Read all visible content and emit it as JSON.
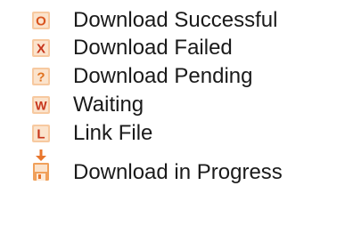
{
  "legend": {
    "items": [
      {
        "icon": "download-successful-icon",
        "glyph": "O",
        "label": "Download Successful",
        "color": "#e8762c"
      },
      {
        "icon": "download-failed-icon",
        "glyph": "X",
        "label": "Download Failed",
        "color": "#e8762c"
      },
      {
        "icon": "download-pending-icon",
        "glyph": "?",
        "label": "Download Pending",
        "color": "#e8762c"
      },
      {
        "icon": "waiting-icon",
        "glyph": "W",
        "label": "Waiting",
        "color": "#e8762c"
      },
      {
        "icon": "link-file-icon",
        "glyph": "L",
        "label": "Link File",
        "color": "#e8762c"
      },
      {
        "icon": "download-in-progress-icon",
        "glyph": "",
        "label": "Download in Progress",
        "color": "#e8762c"
      }
    ]
  }
}
